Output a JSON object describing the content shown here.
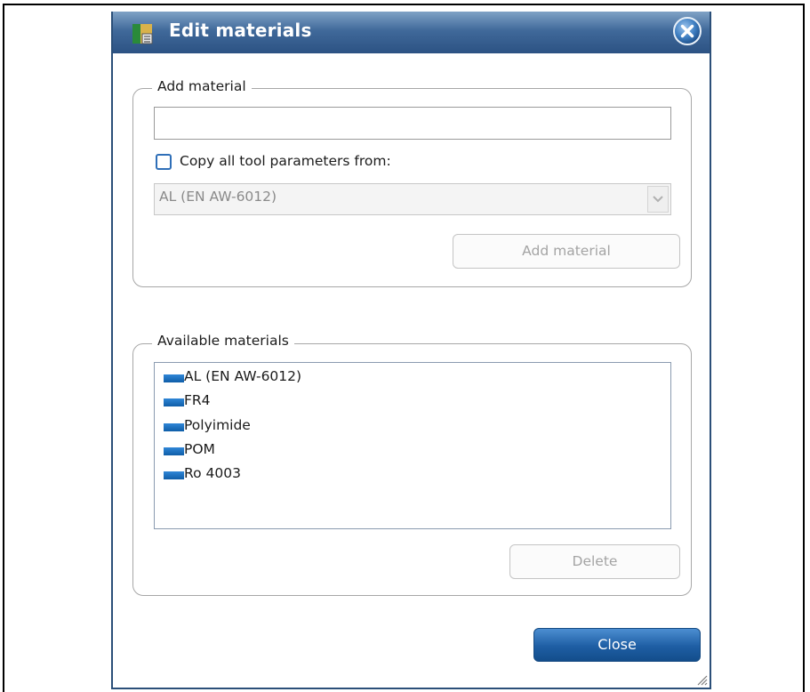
{
  "window": {
    "title": "Edit materials"
  },
  "add_group": {
    "legend": "Add material",
    "name_input_value": "",
    "copy_checkbox_label": "Copy all tool parameters from:",
    "copy_checked": false,
    "copy_source_value": "AL (EN AW-6012)",
    "add_button_label": "Add material"
  },
  "available_group": {
    "legend": "Available materials",
    "items": [
      {
        "label": "AL (EN AW-6012)"
      },
      {
        "label": "FR4"
      },
      {
        "label": "Polyimide"
      },
      {
        "label": "POM"
      },
      {
        "label": "Ro 4003"
      }
    ],
    "delete_button_label": "Delete"
  },
  "footer": {
    "close_button_label": "Close"
  },
  "colors": {
    "titlebar": "#2c5283",
    "accent": "#1e5ea4",
    "swatch": "#1a6fc1"
  }
}
